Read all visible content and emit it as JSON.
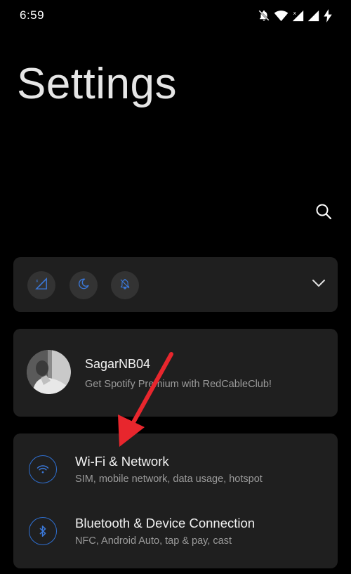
{
  "status_bar": {
    "time": "6:59",
    "icons": [
      "notifications-off-icon",
      "wifi-icon",
      "signal-icon",
      "signal-icon",
      "battery-charging-icon"
    ]
  },
  "header": {
    "title": "Settings",
    "search_icon": "search-icon"
  },
  "quick_settings": {
    "toggles": [
      {
        "icon": "mobile-data-off-icon"
      },
      {
        "icon": "night-mode-icon"
      },
      {
        "icon": "do-not-disturb-icon"
      }
    ],
    "expand_icon": "chevron-down-icon"
  },
  "account": {
    "name": "SagarNB04",
    "promo": "Get Spotify Premium with RedCableClub!"
  },
  "settings_list": [
    {
      "icon": "wifi-icon",
      "title": "Wi-Fi & Network",
      "subtitle": "SIM, mobile network, data usage, hotspot"
    },
    {
      "icon": "bluetooth-icon",
      "title": "Bluetooth & Device Connection",
      "subtitle": "NFC, Android Auto, tap & pay, cast"
    }
  ],
  "colors": {
    "background": "#000000",
    "card": "#1f1f1f",
    "accent": "#2f6fd0",
    "annotation": "#e8262d"
  }
}
